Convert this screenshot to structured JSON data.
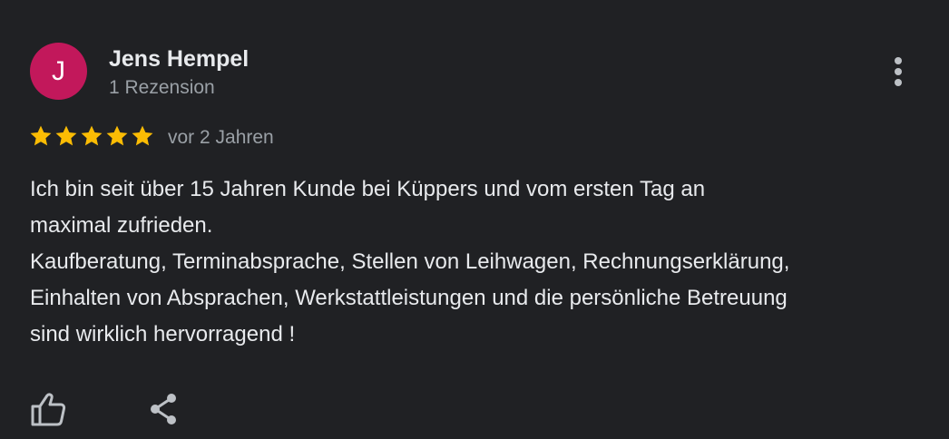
{
  "review": {
    "avatar_letter": "J",
    "avatar_color": "#c2185b",
    "author_name": "Jens Hempel",
    "review_count": "1 Rezension",
    "rating": 5,
    "rating_max": 5,
    "star_color": "#fbbc04",
    "date": "vor 2 Jahren",
    "text_lines": [
      "Ich bin seit über 15 Jahren Kunde bei Küppers und vom ersten Tag an",
      "maximal zufrieden.",
      "Kaufberatung, Terminabsprache, Stellen von Leihwagen, Rechnungserklärung,",
      "Einhalten von Absprachen, Werkstattleistungen und die persönliche Betreuung",
      "sind wirklich hervorragend !"
    ]
  },
  "actions": {
    "more_icon": "more-vert-icon",
    "like_icon": "thumb-up-icon",
    "share_icon": "share-icon"
  }
}
